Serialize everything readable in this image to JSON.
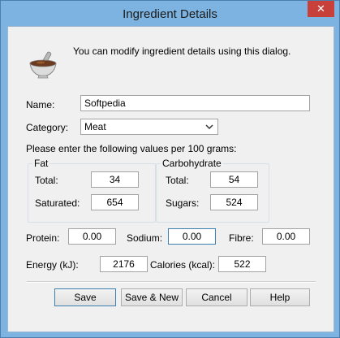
{
  "window": {
    "title": "Ingredient Details",
    "close_glyph": "✕"
  },
  "header": {
    "message": "You can modify ingredient details using this dialog.",
    "icon": "mortar-pestle-icon"
  },
  "form": {
    "name_label": "Name:",
    "name_value": "Softpedia",
    "category_label": "Category:",
    "category_value": "Meat",
    "instructions": "Please enter the following values per 100 grams:",
    "fat": {
      "title": "Fat",
      "total_label": "Total:",
      "total_value": "34",
      "saturated_label": "Saturated:",
      "saturated_value": "654"
    },
    "carbohydrate": {
      "title": "Carbohydrate",
      "total_label": "Total:",
      "total_value": "54",
      "sugars_label": "Sugars:",
      "sugars_value": "524"
    },
    "protein_label": "Protein:",
    "protein_value": "0.00",
    "sodium_label": "Sodium:",
    "sodium_value": "0.00",
    "fibre_label": "Fibre:",
    "fibre_value": "0.00",
    "energy_label": "Energy (kJ):",
    "energy_value": "2176",
    "calories_label": "Calories (kcal):",
    "calories_value": "522"
  },
  "buttons": {
    "save": "Save",
    "save_new": "Save & New",
    "cancel": "Cancel",
    "help": "Help"
  },
  "colors": {
    "title_bar": "#7db3e0",
    "close_button": "#c7403a",
    "dialog_background": "#f0f0f0",
    "focus_border": "#3c7fb1"
  }
}
